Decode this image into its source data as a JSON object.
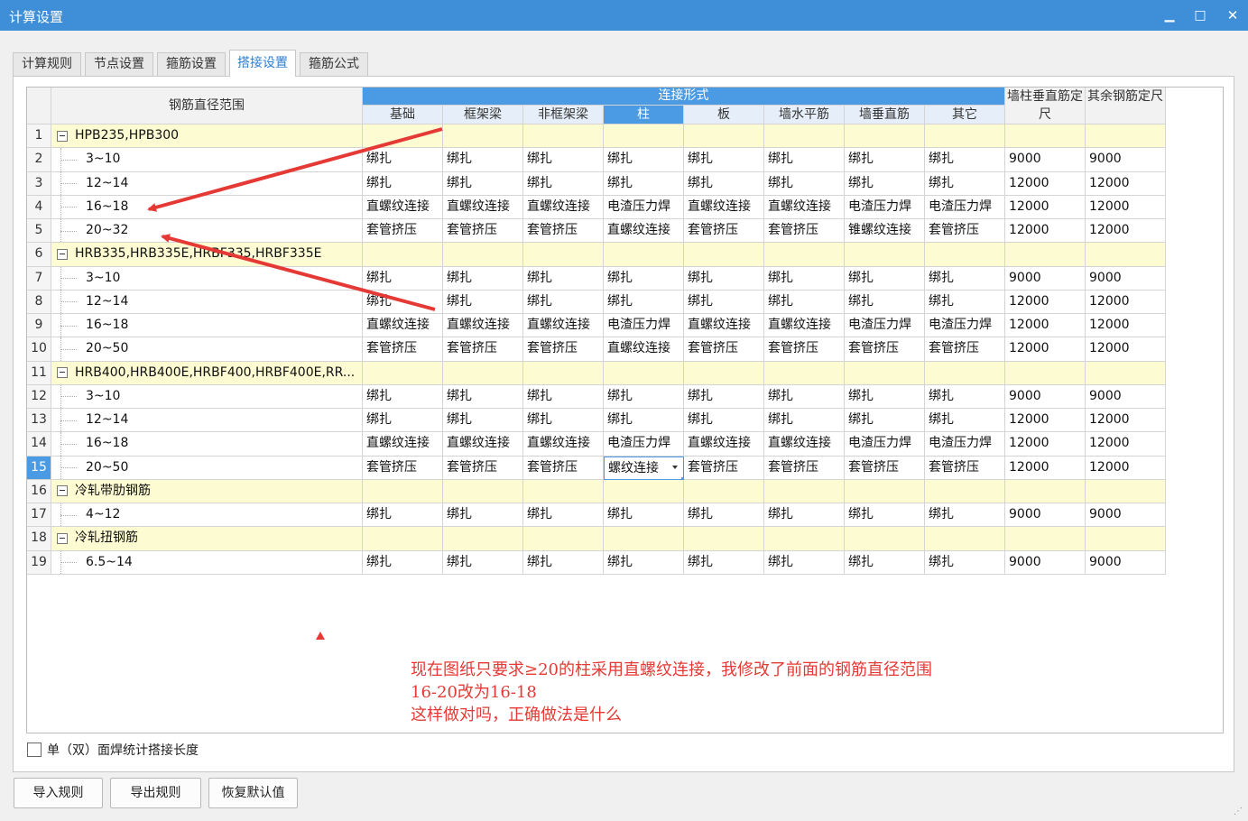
{
  "window": {
    "title": "计算设置",
    "minimize_glyph": "▁",
    "maximize_glyph": "□",
    "close_glyph": "✕"
  },
  "tabs": [
    {
      "label": "计算规则",
      "active": false
    },
    {
      "label": "节点设置",
      "active": false
    },
    {
      "label": "箍筋设置",
      "active": false
    },
    {
      "label": "搭接设置",
      "active": true
    },
    {
      "label": "箍筋公式",
      "active": false
    }
  ],
  "grid": {
    "header": {
      "diameter_range": "钢筋直径范围",
      "connection_form": "连接形式",
      "wall_col_vertical": "墙柱垂直筋定尺",
      "other_rebar": "其余钢筋定尺",
      "columns": [
        "基础",
        "框架梁",
        "非框架梁",
        "柱",
        "板",
        "墙水平筋",
        "墙垂直筋",
        "其它"
      ],
      "selected_column_index": 3
    },
    "selected_row": 15,
    "rows": [
      {
        "num": "1",
        "group": true,
        "label": "HPB235,HPB300"
      },
      {
        "num": "2",
        "label": "3~10",
        "values": [
          "绑扎",
          "绑扎",
          "绑扎",
          "绑扎",
          "绑扎",
          "绑扎",
          "绑扎",
          "绑扎"
        ],
        "len1": "9000",
        "len2": "9000"
      },
      {
        "num": "3",
        "label": "12~14",
        "values": [
          "绑扎",
          "绑扎",
          "绑扎",
          "绑扎",
          "绑扎",
          "绑扎",
          "绑扎",
          "绑扎"
        ],
        "len1": "12000",
        "len2": "12000"
      },
      {
        "num": "4",
        "label": "16~18",
        "values": [
          "直螺纹连接",
          "直螺纹连接",
          "直螺纹连接",
          "电渣压力焊",
          "直螺纹连接",
          "直螺纹连接",
          "电渣压力焊",
          "电渣压力焊"
        ],
        "len1": "12000",
        "len2": "12000"
      },
      {
        "num": "5",
        "label": "20~32",
        "values": [
          "套管挤压",
          "套管挤压",
          "套管挤压",
          "直螺纹连接",
          "套管挤压",
          "套管挤压",
          "锥螺纹连接",
          "套管挤压"
        ],
        "len1": "12000",
        "len2": "12000"
      },
      {
        "num": "6",
        "group": true,
        "label": "HRB335,HRB335E,HRBF335,HRBF335E"
      },
      {
        "num": "7",
        "label": "3~10",
        "values": [
          "绑扎",
          "绑扎",
          "绑扎",
          "绑扎",
          "绑扎",
          "绑扎",
          "绑扎",
          "绑扎"
        ],
        "len1": "9000",
        "len2": "9000"
      },
      {
        "num": "8",
        "label": "12~14",
        "values": [
          "绑扎",
          "绑扎",
          "绑扎",
          "绑扎",
          "绑扎",
          "绑扎",
          "绑扎",
          "绑扎"
        ],
        "len1": "12000",
        "len2": "12000"
      },
      {
        "num": "9",
        "label": "16~18",
        "values": [
          "直螺纹连接",
          "直螺纹连接",
          "直螺纹连接",
          "电渣压力焊",
          "直螺纹连接",
          "直螺纹连接",
          "电渣压力焊",
          "电渣压力焊"
        ],
        "len1": "12000",
        "len2": "12000"
      },
      {
        "num": "10",
        "label": "20~50",
        "values": [
          "套管挤压",
          "套管挤压",
          "套管挤压",
          "直螺纹连接",
          "套管挤压",
          "套管挤压",
          "套管挤压",
          "套管挤压"
        ],
        "len1": "12000",
        "len2": "12000"
      },
      {
        "num": "11",
        "group": true,
        "label": "HRB400,HRB400E,HRBF400,HRBF400E,RR..."
      },
      {
        "num": "12",
        "label": "3~10",
        "values": [
          "绑扎",
          "绑扎",
          "绑扎",
          "绑扎",
          "绑扎",
          "绑扎",
          "绑扎",
          "绑扎"
        ],
        "len1": "9000",
        "len2": "9000"
      },
      {
        "num": "13",
        "label": "12~14",
        "values": [
          "绑扎",
          "绑扎",
          "绑扎",
          "绑扎",
          "绑扎",
          "绑扎",
          "绑扎",
          "绑扎"
        ],
        "len1": "12000",
        "len2": "12000"
      },
      {
        "num": "14",
        "label": "16~18",
        "values": [
          "直螺纹连接",
          "直螺纹连接",
          "直螺纹连接",
          "电渣压力焊",
          "直螺纹连接",
          "直螺纹连接",
          "电渣压力焊",
          "电渣压力焊"
        ],
        "len1": "12000",
        "len2": "12000"
      },
      {
        "num": "15",
        "label": "20~50",
        "values": [
          "套管挤压",
          "套管挤压",
          "套管挤压",
          "螺纹连接",
          "套管挤压",
          "套管挤压",
          "套管挤压",
          "套管挤压"
        ],
        "len1": "12000",
        "len2": "12000",
        "editing_col": 3
      },
      {
        "num": "16",
        "group": true,
        "label": "冷轧带肋钢筋"
      },
      {
        "num": "17",
        "label": "4~12",
        "values": [
          "绑扎",
          "绑扎",
          "绑扎",
          "绑扎",
          "绑扎",
          "绑扎",
          "绑扎",
          "绑扎"
        ],
        "len1": "9000",
        "len2": "9000"
      },
      {
        "num": "18",
        "group": true,
        "label": "冷轧扭钢筋"
      },
      {
        "num": "19",
        "label": "6.5~14",
        "values": [
          "绑扎",
          "绑扎",
          "绑扎",
          "绑扎",
          "绑扎",
          "绑扎",
          "绑扎",
          "绑扎"
        ],
        "len1": "9000",
        "len2": "9000"
      }
    ]
  },
  "annotation": {
    "lines": [
      "现在图纸只要求≥20的柱采用直螺纹连接，我修改了前面的钢筋直径范围",
      "16-20改为16-18",
      "这样做对吗，正确做法是什么"
    ],
    "color": "#e53935"
  },
  "checkbox": {
    "label": "单（双）面焊统计搭接长度",
    "checked": false
  },
  "buttons": {
    "import": "导入规则",
    "export": "导出规则",
    "restore": "恢复默认值"
  },
  "colors": {
    "titlebar": "#3f8fd8",
    "header_blue": "#4a9ae4",
    "group_row": "#fcfbd2",
    "active_tab_text": "#2b7fd4"
  }
}
